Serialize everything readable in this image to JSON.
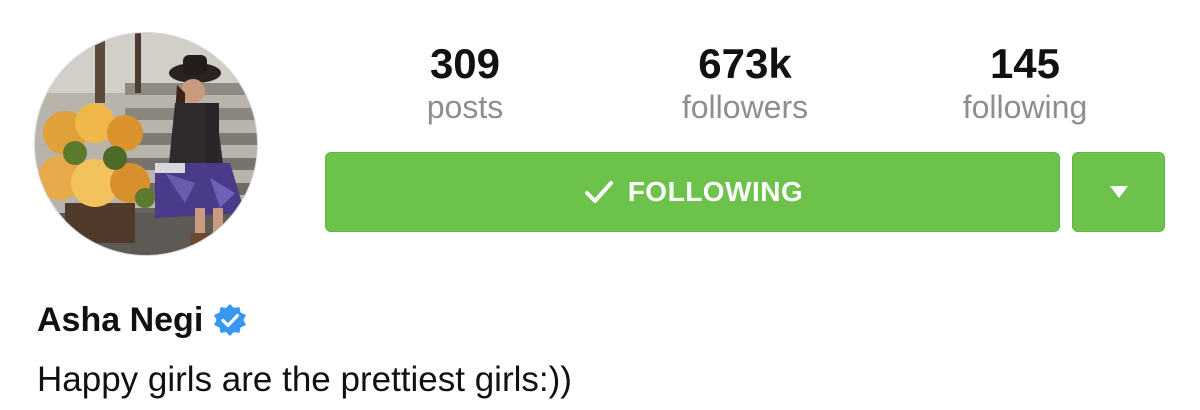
{
  "profile": {
    "avatar_icon": "profile-photo",
    "name": "Asha Negi",
    "verified_icon": "verified-badge-icon",
    "bio": "Happy girls are the prettiest girls:))"
  },
  "stats": {
    "posts_count": "309",
    "posts_label": "posts",
    "followers_count": "673k",
    "followers_label": "followers",
    "following_count": "145",
    "following_label": "following"
  },
  "actions": {
    "following_label": "FOLLOWING",
    "following_icon": "checkmark-icon",
    "dropdown_icon": "triangle-down-icon"
  },
  "colors": {
    "button_green": "#6cc24a",
    "verified_blue": "#3897f0",
    "label_gray": "#8e8e8e"
  }
}
